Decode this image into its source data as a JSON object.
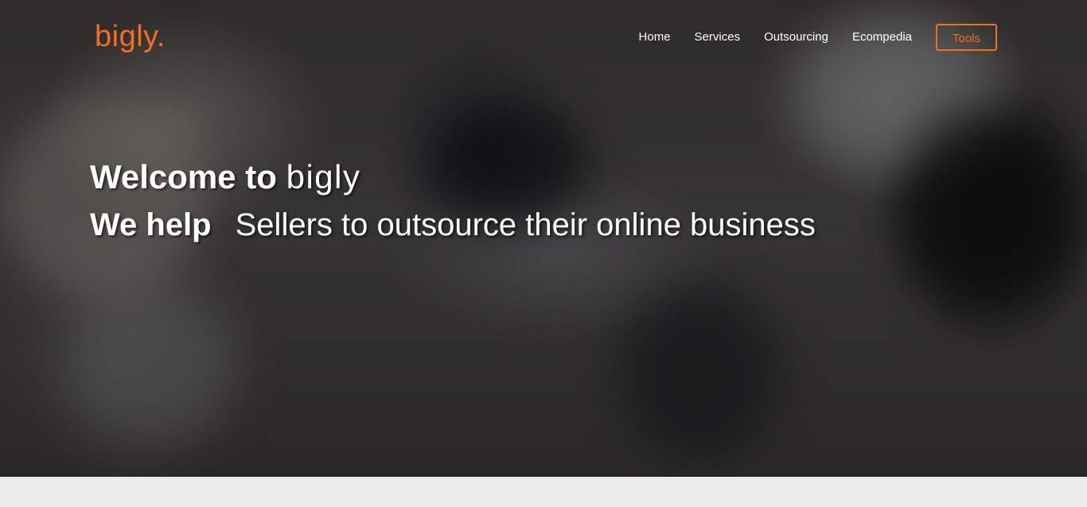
{
  "brand": {
    "logo_text": "bigly.",
    "accent_color": "#f26f21"
  },
  "nav": {
    "items": [
      "Home",
      "Services",
      "Outsourcing",
      "Ecompedia"
    ],
    "tools_label": "Tools"
  },
  "hero": {
    "welcome_lead": "Welcome to",
    "welcome_brand": "bigly",
    "tagline_lead": "We help",
    "tagline_rest": "Sellers to outsource their online business",
    "background": "blurred office photo"
  }
}
